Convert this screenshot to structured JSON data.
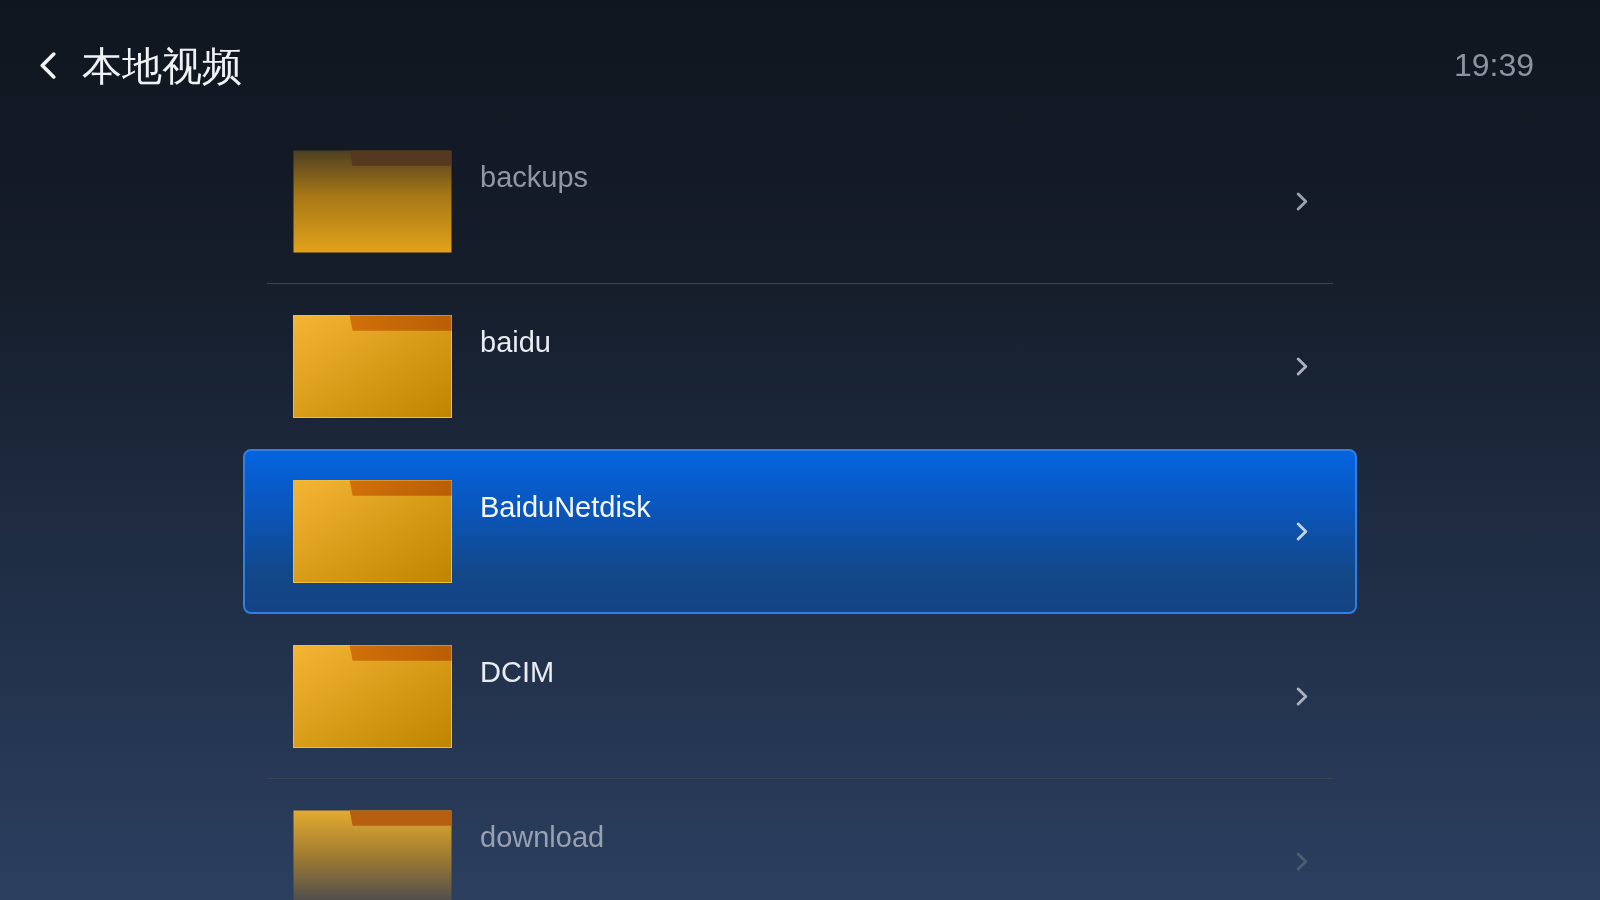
{
  "header": {
    "title": "本地视频",
    "time": "19:39"
  },
  "folders": [
    {
      "name": "backups",
      "selected": false,
      "faded": true
    },
    {
      "name": "baidu",
      "selected": false,
      "faded": false
    },
    {
      "name": "BaiduNetdisk",
      "selected": true,
      "faded": false
    },
    {
      "name": "DCIM",
      "selected": false,
      "faded": false
    },
    {
      "name": "download",
      "selected": false,
      "faded": true
    }
  ]
}
